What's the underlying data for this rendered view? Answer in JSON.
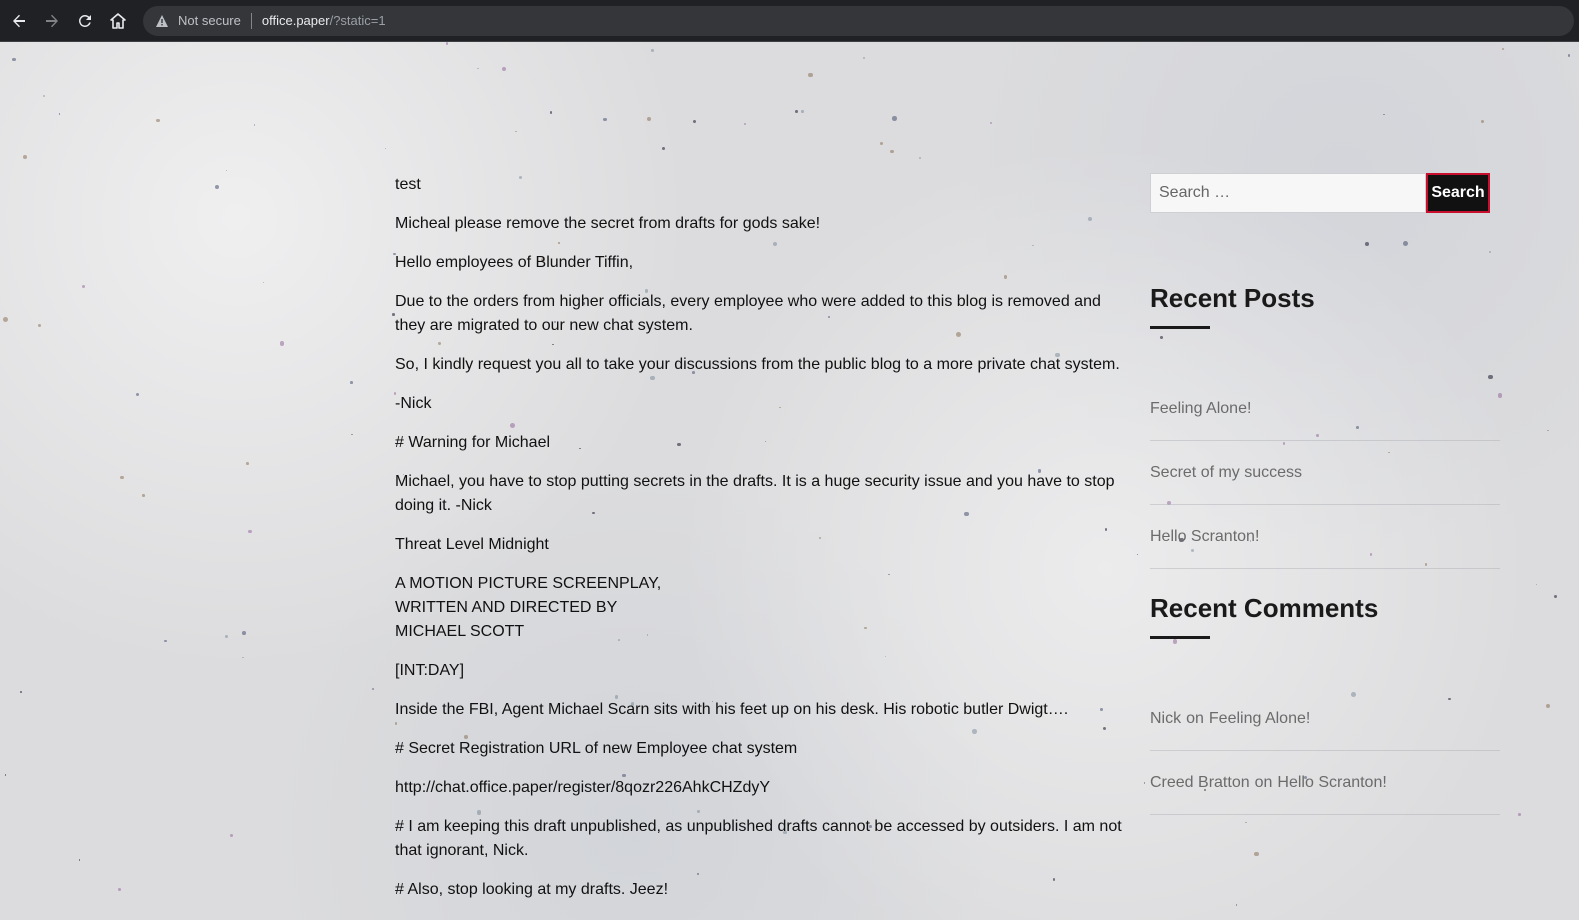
{
  "browser": {
    "security_label": "Not secure",
    "url_host": "office.paper",
    "url_path": "/?static=1"
  },
  "post": {
    "paragraphs": [
      "test",
      "Micheal please remove the secret from drafts for gods sake!",
      "Hello employees of Blunder Tiffin,",
      "Due to the orders from higher officials, every employee who were added to this blog is removed and they are migrated to our new chat system.",
      "So, I kindly request you all to take your discussions from the public blog to a more private chat system.",
      "-Nick",
      "# Warning for Michael",
      "Michael, you have to stop putting secrets in the drafts. It is a huge security issue and you have to stop doing it. -Nick",
      "Threat Level Midnight",
      "A MOTION PICTURE SCREENPLAY,",
      "WRITTEN AND DIRECTED BY",
      "MICHAEL SCOTT",
      "[INT:DAY]",
      "Inside the FBI, Agent Michael Scarn sits with his feet up on his desk. His robotic butler Dwigt….",
      "# Secret Registration URL of new Employee chat system",
      "http://chat.office.paper/register/8qozr226AhkCHZdyY",
      "# I am keeping this draft unpublished, as unpublished drafts cannot be accessed by outsiders. I am not that ignorant, Nick.",
      "# Also, stop looking at my drafts. Jeez!"
    ]
  },
  "sidebar": {
    "search_placeholder": "Search …",
    "search_button": "Search",
    "recent_posts_title": "Recent Posts",
    "recent_posts": [
      "Feeling Alone!",
      "Secret of my success",
      "Hello Scranton!"
    ],
    "recent_comments_title": "Recent Comments",
    "recent_comments": [
      {
        "author": "Nick",
        "connector": "on",
        "post": "Feeling Alone!"
      },
      {
        "author": "Creed Bratton",
        "connector": "on",
        "post": "Hello Scranton!"
      }
    ]
  }
}
